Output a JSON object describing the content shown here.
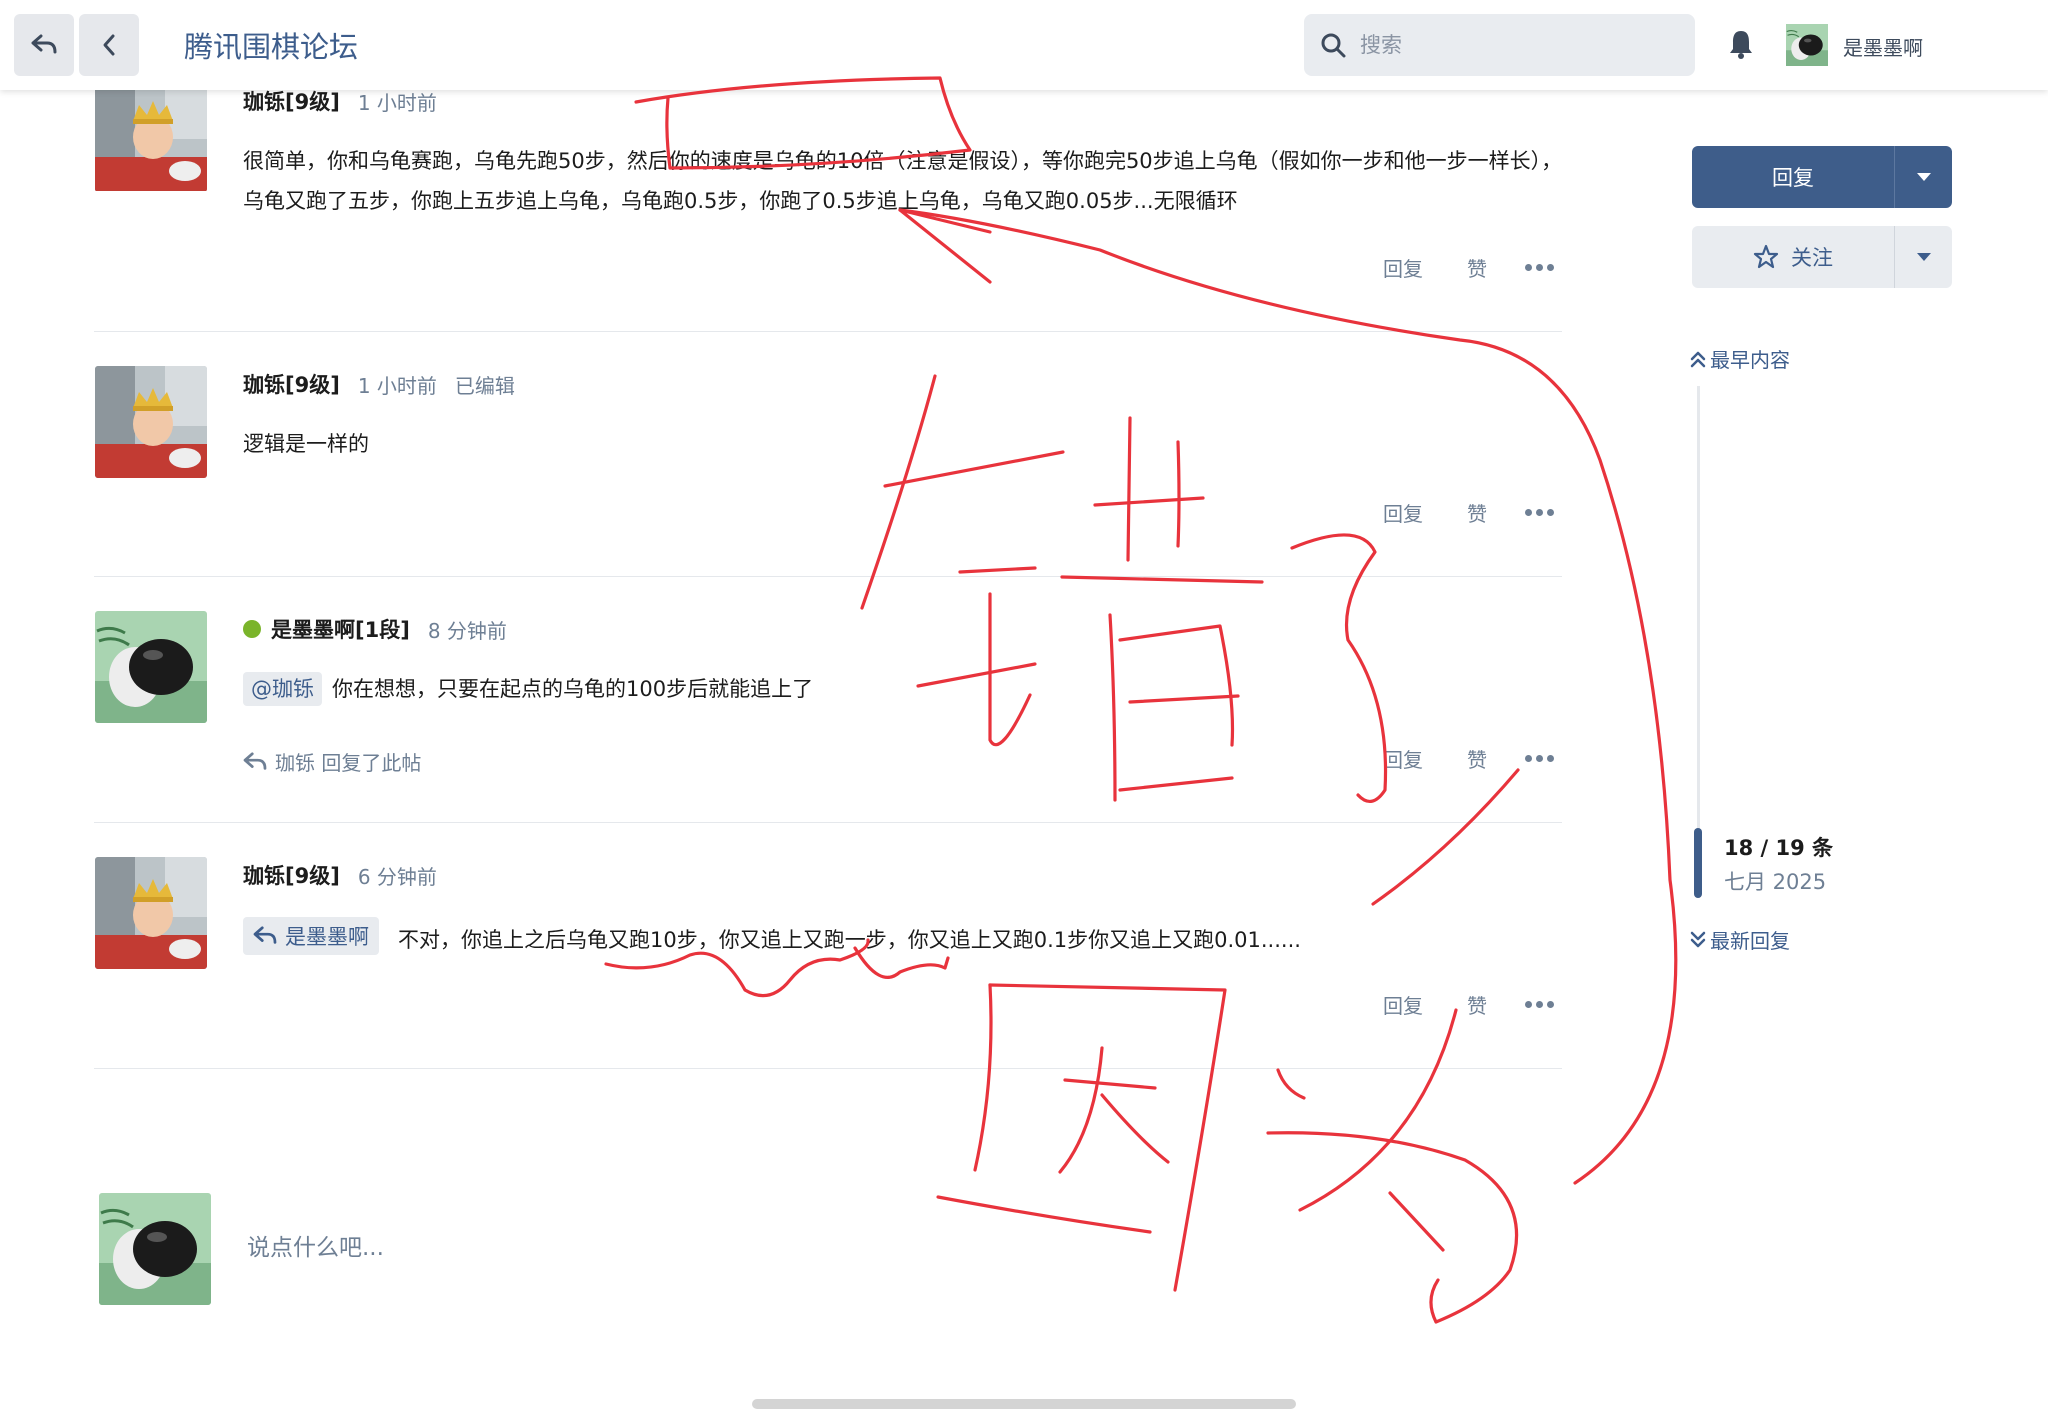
{
  "header": {
    "title": "腾讯围棋论坛",
    "search_placeholder": "搜索",
    "user_name": "是墨墨啊"
  },
  "posts": [
    {
      "author": "珈铄[9级]",
      "time": "1 小时前",
      "text": "很简单，你和乌龟赛跑，乌龟先跑50步，然后你的速度是乌龟的10倍（注意是假设），等你跑完50步追上乌龟（假如你一步和他一步一样长），乌龟又跑了五步，你跑上五步追上乌龟，乌龟跑0.5步，你跑了0.5步追上乌龟，乌龟又跑0.05步...无限循环"
    },
    {
      "author": "珈铄[9级]",
      "time": "1 小时前",
      "edited": "已编辑",
      "text": "逻辑是一样的"
    },
    {
      "author": "是墨墨啊[1段]",
      "time": "8 分钟前",
      "mention": "@珈铄",
      "text": "你在想想，只要在起点的乌龟的100步后就能追上了",
      "replied_to": "珈铄 回复了此帖"
    },
    {
      "author": "珈铄[9级]",
      "time": "6 分钟前",
      "quote_user": "是墨墨啊",
      "text": "不对，你追上之后乌龟又跑10步，你又追上又跑一步，你又追上又跑0.1步你又追上又跑0.01......"
    }
  ],
  "post_actions": {
    "reply": "回复",
    "like": "赞"
  },
  "composer": {
    "placeholder": "说点什么吧..."
  },
  "sidebar": {
    "reply_button": "回复",
    "follow_button": "关注",
    "earliest": "最早内容",
    "latest": "最新回复",
    "position": "18 / 19 条",
    "date": "七月 2025"
  },
  "colors": {
    "accent": "#3e5d8a",
    "link": "#3d5d8c",
    "muted": "#6e7f94",
    "online": "#7ab42a",
    "annotation": "#e8333c"
  }
}
